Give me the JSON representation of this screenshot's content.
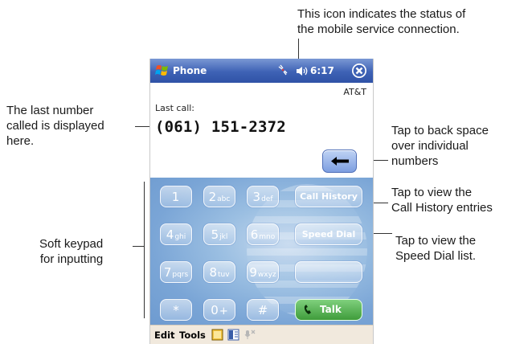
{
  "callouts": {
    "connection_status": [
      "This icon indicates the status of",
      "the mobile service connection."
    ],
    "last_number": [
      "The last number",
      "called is displayed",
      "here."
    ],
    "backspace": [
      "Tap to back space",
      "over individual",
      "numbers"
    ],
    "call_history": [
      "Tap to view the",
      "Call History entries"
    ],
    "speed_dial": [
      "Tap to view the",
      "Speed Dial list."
    ],
    "soft_keypad": [
      "Soft keypad",
      "for inputting"
    ]
  },
  "titlebar": {
    "app_title": "Phone",
    "time": "6:17",
    "icons": [
      "start-flag-icon",
      "connection-status-icon",
      "speaker-icon",
      "close-icon"
    ]
  },
  "screen": {
    "carrier": "AT&T",
    "last_call_label": "Last call:",
    "last_call_number": "(061) 151-2372"
  },
  "keypad": {
    "keys": [
      {
        "digit": "1",
        "letters": ""
      },
      {
        "digit": "2",
        "letters": "abc"
      },
      {
        "digit": "3",
        "letters": "def"
      },
      {
        "digit": "4",
        "letters": "ghi"
      },
      {
        "digit": "5",
        "letters": "jkl"
      },
      {
        "digit": "6",
        "letters": "mno"
      },
      {
        "digit": "7",
        "letters": "pqrs"
      },
      {
        "digit": "8",
        "letters": "tuv"
      },
      {
        "digit": "9",
        "letters": "wxyz"
      },
      {
        "digit": "*",
        "letters": ""
      },
      {
        "digit": "0",
        "letters": "+"
      },
      {
        "digit": "#",
        "letters": ""
      }
    ],
    "call_history_label": "Call History",
    "speed_dial_label": "Speed Dial",
    "talk_label": "Talk"
  },
  "menubar": {
    "edit_label": "Edit",
    "tools_label": "Tools"
  },
  "colors": {
    "titlebar": "#3e62b5",
    "keypad": "#9bbfe2",
    "talk": "#3f9c3b",
    "menubar": "#f1e9dd"
  }
}
